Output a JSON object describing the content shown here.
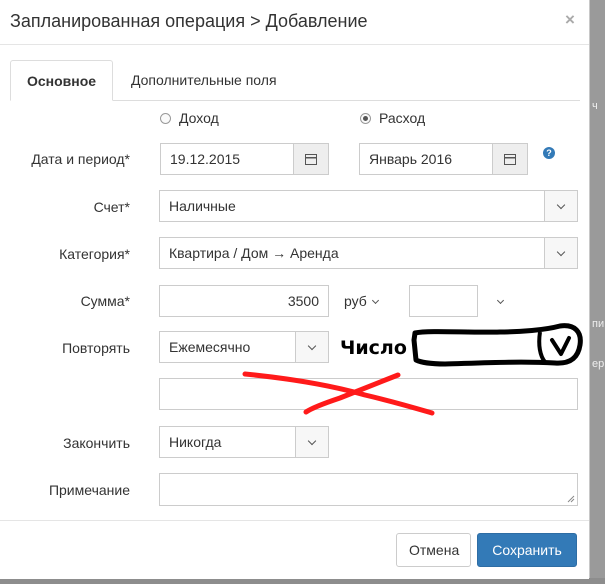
{
  "modal": {
    "title": "Запланированная операция > Добавление",
    "close_glyph": "×"
  },
  "tabs": [
    {
      "label": "Основное",
      "active": true
    },
    {
      "label": "Дополнительные поля",
      "active": false
    }
  ],
  "type_radio": {
    "income_label": "Доход",
    "expense_label": "Расход",
    "selected": "Расход"
  },
  "form": {
    "date_label": "Дата и период*",
    "date_value": "19.12.2015",
    "period_value": "Январь 2016",
    "account_label": "Счет*",
    "account_value": "Наличные",
    "category_label": "Категория*",
    "category_value": "Квартира / Дом → Аренда",
    "amount_label": "Сумма*",
    "amount_value": "3500",
    "currency_value": "руб",
    "extra_value": "",
    "repeat_label": "Повторять",
    "repeat_value": "Ежемесячно",
    "handwritten_label": "Число",
    "custom_value": "",
    "end_label": "Закончить",
    "end_value": "Никогда",
    "note_label": "Примечание",
    "note_value": ""
  },
  "footer": {
    "cancel_label": "Отмена",
    "save_label": "Сохранить"
  },
  "background": {
    "text1": "ч",
    "text2": "пи",
    "text3": "ер"
  },
  "icons": {
    "calendar": "calendar-icon",
    "chevron": "chevron-down-icon",
    "help": "question-icon"
  },
  "colors": {
    "primary": "#337ab7",
    "annotation_red": "#ff1a1a",
    "annotation_black": "#000000"
  }
}
